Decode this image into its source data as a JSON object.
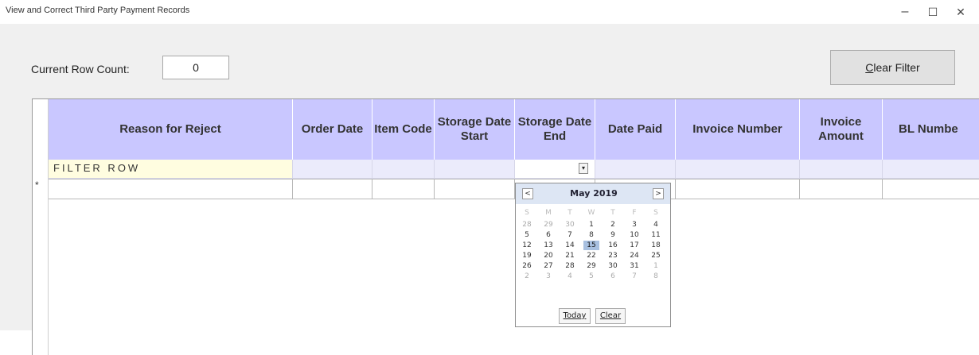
{
  "window": {
    "title": "View and Correct Third Party Payment Records",
    "minimize": "–",
    "maximize": "☐",
    "close": "✕"
  },
  "toolbar": {
    "row_count_label": "Current Row Count:",
    "row_count_value": "0",
    "clear_filter_prefix": "C",
    "clear_filter_rest": "lear Filter"
  },
  "grid": {
    "columns": [
      "Reason for Reject",
      "Order Date",
      "Item Code",
      "Storage Date Start",
      "Storage Date End",
      "Date Paid",
      "Invoice Number",
      "Invoice Amount",
      "BL Numbe"
    ],
    "filter_row_label": "FILTER ROW",
    "new_row_marker": "*"
  },
  "calendar": {
    "month_title": "May 2019",
    "prev": "<",
    "next": ">",
    "weekdays": [
      "S",
      "M",
      "T",
      "W",
      "T",
      "F",
      "S"
    ],
    "weeks": [
      [
        "28",
        "29",
        "30",
        "1",
        "2",
        "3",
        "4"
      ],
      [
        "5",
        "6",
        "7",
        "8",
        "9",
        "10",
        "11"
      ],
      [
        "12",
        "13",
        "14",
        "15",
        "16",
        "17",
        "18"
      ],
      [
        "19",
        "20",
        "21",
        "22",
        "23",
        "24",
        "25"
      ],
      [
        "26",
        "27",
        "28",
        "29",
        "30",
        "31",
        "1"
      ],
      [
        "2",
        "3",
        "4",
        "5",
        "6",
        "7",
        "8"
      ]
    ],
    "selected_day": "15",
    "today_button": "Today",
    "clear_button": "Clear"
  }
}
